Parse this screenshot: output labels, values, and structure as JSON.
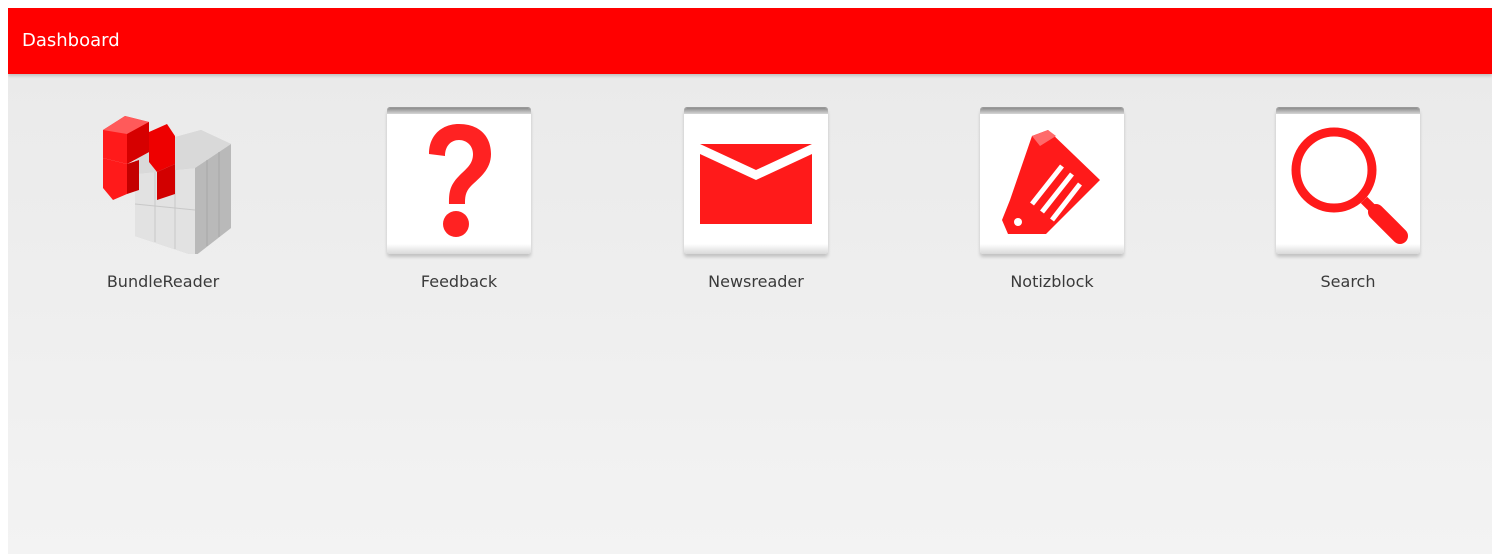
{
  "actionbar": {
    "title": "Dashboard",
    "color": "#ff0000"
  },
  "tiles": [
    {
      "label": "BundleReader",
      "icon": "cube-icon"
    },
    {
      "label": "Feedback",
      "icon": "question-mark-icon"
    },
    {
      "label": "Newsreader",
      "icon": "envelope-icon"
    },
    {
      "label": "Notizblock",
      "icon": "tag-icon"
    },
    {
      "label": "Search",
      "icon": "magnifier-icon"
    }
  ],
  "accent_color": "#ff0000"
}
